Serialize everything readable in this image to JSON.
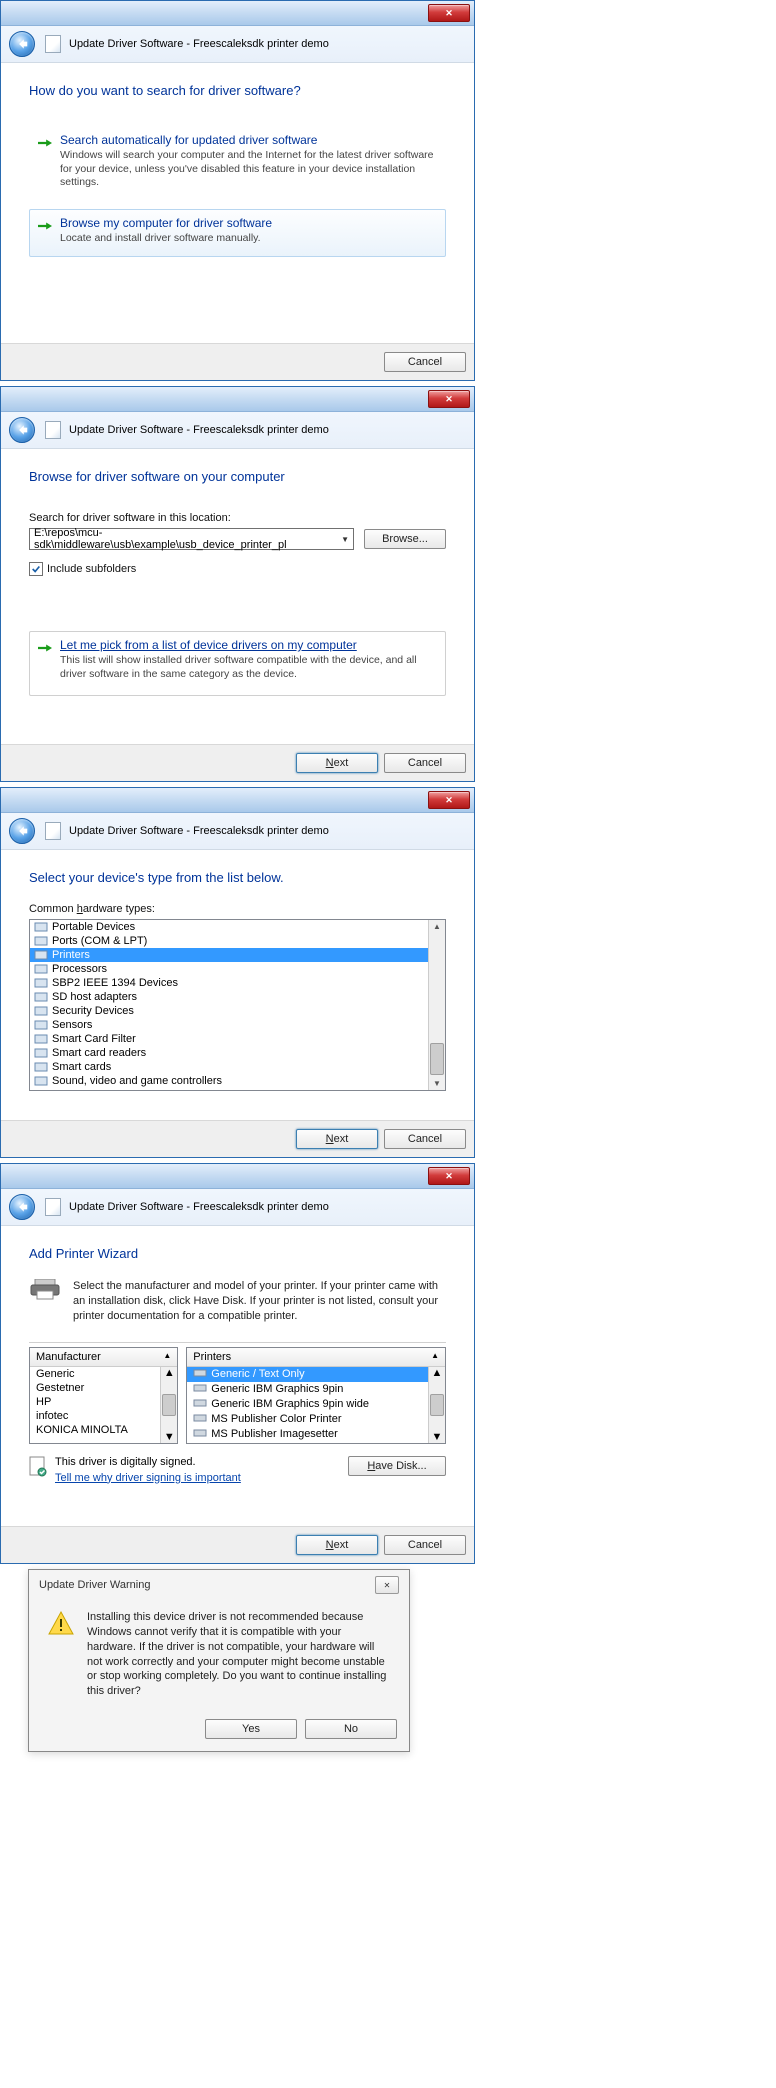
{
  "window_title": "Update Driver Software - Freescaleksdk printer demo",
  "close_x": "✕",
  "dialog1": {
    "heading": "How do you want to search for driver software?",
    "opt1_title": "Search automatically for updated driver software",
    "opt1_desc": "Windows will search your computer and the Internet for the latest driver software for your device, unless you've disabled this feature in your device installation settings.",
    "opt2_title": "Browse my computer for driver software",
    "opt2_desc": "Locate and install driver software manually.",
    "cancel": "Cancel"
  },
  "dialog2": {
    "heading": "Browse for driver software on your computer",
    "path_label": "Search for driver software in this location:",
    "path_value": "E:\\repos\\mcu-sdk\\middleware\\usb\\example\\usb_device_printer_pl",
    "browse": "Browse...",
    "include_sub": "Include subfolders",
    "pick_title": "Let me pick from a list of device drivers on my computer",
    "pick_desc": "This list will show installed driver software compatible with the device, and all driver software in the same category as the device.",
    "next": "Next",
    "cancel": "Cancel"
  },
  "dialog3": {
    "heading": "Select your device's type from the list below.",
    "list_label": "Common hardware types:",
    "items": [
      "Portable Devices",
      "Ports (COM & LPT)",
      "Printers",
      "Processors",
      "SBP2 IEEE 1394 Devices",
      "SD host adapters",
      "Security Devices",
      "Sensors",
      "Smart Card Filter",
      "Smart card readers",
      "Smart cards",
      "Sound, video and game controllers"
    ],
    "selected_index": 2,
    "next": "Next",
    "cancel": "Cancel"
  },
  "dialog4": {
    "heading": "Add Printer Wizard",
    "desc": "Select the manufacturer and model of your printer. If your printer came with an installation disk, click Have Disk. If your printer is not listed, consult your printer documentation for a compatible printer.",
    "manu_head": "Manufacturer",
    "manufacturers": [
      "Generic",
      "Gestetner",
      "HP",
      "infotec",
      "KONICA MINOLTA"
    ],
    "prn_head": "Printers",
    "printers": [
      "Generic / Text Only",
      "Generic IBM Graphics 9pin",
      "Generic IBM Graphics 9pin wide",
      "MS Publisher Color Printer",
      "MS Publisher Imagesetter"
    ],
    "prn_selected_index": 0,
    "signed_text": "This driver is digitally signed.",
    "why_link": "Tell me why driver signing is important",
    "have_disk": "Have Disk...",
    "next": "Next",
    "cancel": "Cancel"
  },
  "warn": {
    "title": "Update Driver Warning",
    "body": "Installing this device driver is not recommended because Windows cannot verify that it is compatible with your hardware.  If the driver is not compatible, your hardware will not work correctly and your computer might become unstable or stop working completely.  Do you want to continue installing this driver?",
    "yes": "Yes",
    "no": "No"
  }
}
